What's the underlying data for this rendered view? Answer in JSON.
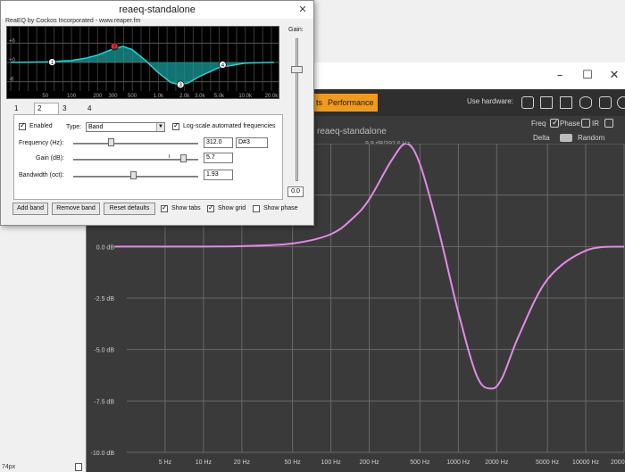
{
  "host": {
    "win_min": "–",
    "win_max": "☐",
    "win_close": "✕",
    "tab_prev": "ts",
    "tab_performance": "Performance",
    "use_hardware": "Use hardware:",
    "analyzer_title": "reaeq-standalone",
    "analyzer_readout": "9.9 dB/392.6 Hz",
    "options": {
      "freq": "Freq",
      "phase": "Phase",
      "ir": "IR",
      "delta": "Delta",
      "random": "Random"
    },
    "plot": {
      "curve_color": "#e48ae8",
      "grid_color": "#6a6a6a",
      "y_ticks": [
        "",
        "2.5 dB",
        "0.0 dB",
        "-2.5 dB",
        "-5.0 dB",
        "-7.5 dB",
        "-10.0 dB"
      ],
      "x_ticks": [
        "5 Hz",
        "10 Hz",
        "20 Hz",
        "50 Hz",
        "100 Hz",
        "200 Hz",
        "500 Hz",
        "1000 Hz",
        "2000 Hz",
        "5000 Hz",
        "10000 Hz",
        "20000 Hz"
      ]
    }
  },
  "chart_data": {
    "type": "line",
    "title": "reaeq-standalone",
    "xlabel": "",
    "ylabel": "",
    "x_scale": "log",
    "ylim": [
      -10,
      5
    ],
    "series": [
      {
        "x": [
          2,
          10,
          20,
          50,
          100,
          150,
          200,
          300,
          392.6,
          500,
          700,
          1000,
          1400,
          1800,
          2200,
          3000,
          5000,
          10000,
          20000
        ],
        "y": [
          0.0,
          0.0,
          0.02,
          0.15,
          0.6,
          1.4,
          2.3,
          4.2,
          5.0,
          4.0,
          0.8,
          -3.2,
          -6.3,
          -6.9,
          -6.4,
          -4.3,
          -1.6,
          -0.2,
          0.0
        ]
      }
    ]
  },
  "reaeq": {
    "title": "reaeq-standalone",
    "close": "✕",
    "credit": "ReaEQ by Cockos Incorporated - www.reaper.fm",
    "gain_label": "Gain:",
    "gain_value": "0.0",
    "eq_db_labels": [
      "+6",
      "+0",
      "-6"
    ],
    "eq_freq_labels": [
      "50",
      "100",
      "200",
      "300",
      "500",
      "1.0k",
      "2.0k",
      "3.0k",
      "5.0k",
      "10.0k",
      "20.0k"
    ],
    "eq_fill_color": "#1a9a9a",
    "eq_line_color": "#2ecfcf",
    "nodes": [
      "1",
      "2",
      "3",
      "4"
    ],
    "tabs": [
      "1",
      "2",
      "3",
      "4"
    ],
    "enabled_label": "Enabled",
    "type_label": "Type:",
    "type_value": "Band",
    "logscale_label": "Log-scale automated frequencies",
    "freq_label": "Frequency (Hz):",
    "freq_value": "312.0",
    "note_value": "D#3",
    "gain_db_label": "Gain (dB):",
    "gain_db_value": "5.7",
    "bw_label": "Bandwidth (oct):",
    "bw_value": "1.93",
    "add_band": "Add band",
    "remove_band": "Remove band",
    "reset_defaults": "Reset defaults",
    "show_tabs": "Show tabs",
    "show_grid": "Show grid",
    "show_phase": "Show phase"
  },
  "taskbar": {
    "hint": "74px"
  }
}
